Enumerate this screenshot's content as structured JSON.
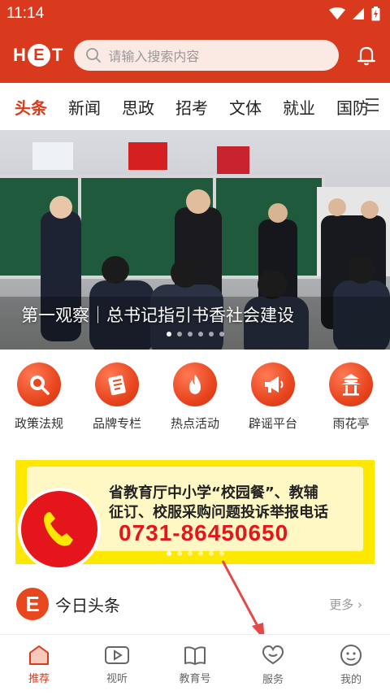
{
  "status": {
    "time": "11:14"
  },
  "header": {
    "logo_letters": [
      "H",
      "E",
      "T"
    ],
    "search_placeholder": "请输入搜索内容"
  },
  "tabs": [
    {
      "label": "头条",
      "active": true
    },
    {
      "label": "新闻"
    },
    {
      "label": "思政"
    },
    {
      "label": "招考"
    },
    {
      "label": "文体"
    },
    {
      "label": "就业"
    },
    {
      "label": "国防"
    }
  ],
  "banner": {
    "caption": "第一观察｜总书记指引书香社会建设",
    "slide_count": 6,
    "active_slide": 0
  },
  "quick_links": [
    {
      "label": "政策法规",
      "icon": "search-doc-icon"
    },
    {
      "label": "品牌专栏",
      "icon": "notebook-icon"
    },
    {
      "label": "热点活动",
      "icon": "flame-icon"
    },
    {
      "label": "辟谣平台",
      "icon": "megaphone-icon"
    },
    {
      "label": "雨花亭",
      "icon": "pavilion-icon"
    }
  ],
  "ad": {
    "line1": "省教育厅中小学“校园餐”、教辅",
    "line2": "征订、校服采购问题投诉举报电话",
    "phone": "0731-86450650",
    "slide_count": 6,
    "active_slide": 0
  },
  "section": {
    "logo_letter": "E",
    "title": "今日头条",
    "more": "更多"
  },
  "nav": [
    {
      "label": "推荐",
      "icon": "home-icon",
      "active": true
    },
    {
      "label": "视听",
      "icon": "video-icon"
    },
    {
      "label": "教育号",
      "icon": "book-icon"
    },
    {
      "label": "服务",
      "icon": "heart-icon"
    },
    {
      "label": "我的",
      "icon": "smile-icon"
    }
  ],
  "colors": {
    "brand": "#d93a1e",
    "accent": "#e8461f",
    "ad_yellow": "#ffe800",
    "ad_red": "#e4161c"
  }
}
